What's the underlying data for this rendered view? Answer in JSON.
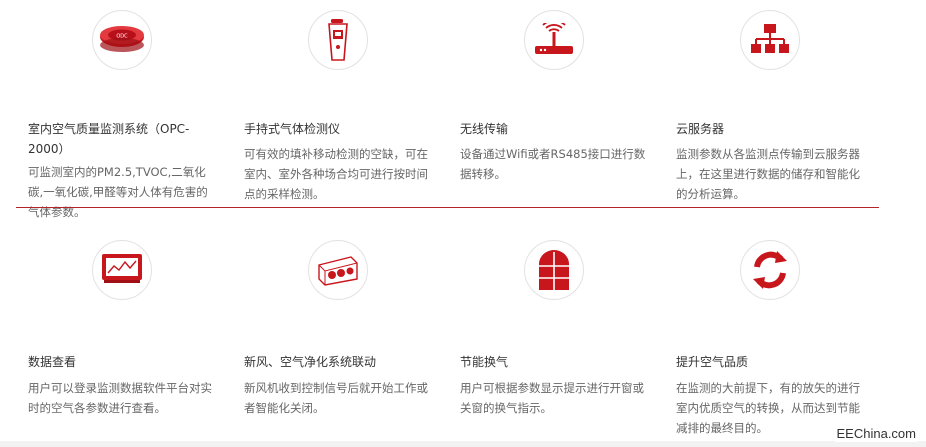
{
  "features": [
    {
      "title": "室内空气质量监测系统（OPC-2000）",
      "desc": "可监测室内的PM2.5,TVOC,二氧化碳,一氧化碳,甲醛等对人体有危害的气体参数。",
      "icon": "ceiling-sensor-icon"
    },
    {
      "title": "手持式气体检测仪",
      "desc": "可有效的填补移动检测的空缺，可在室内、室外各种场合均可进行按时间点的采样检测。",
      "icon": "handheld-detector-icon"
    },
    {
      "title": "无线传输",
      "desc": "设备通过Wifi或者RS485接口进行数据转移。",
      "icon": "wifi-router-icon"
    },
    {
      "title": "云服务器",
      "desc": "监测参数从各监测点传输到云服务器上，在这里进行数据的储存和智能化的分析运算。",
      "icon": "network-servers-icon"
    },
    {
      "title": "数据查看",
      "desc": "用户可以登录监测数据软件平台对实时的空气各参数进行查看。",
      "icon": "monitor-chart-icon"
    },
    {
      "title": "新风、空气净化系统联动",
      "desc": "新风机收到控制信号后就开始工作或者智能化关闭。",
      "icon": "fresh-air-unit-icon"
    },
    {
      "title": "节能换气",
      "desc": "用户可根据参数显示提示进行开窗或关窗的换气指示。",
      "icon": "window-icon"
    },
    {
      "title": "提升空气品质",
      "desc": "在监测的大前提下，有的放矢的进行室内优质空气的转换，从而达到节能减排的最终目的。",
      "icon": "refresh-cycle-icon"
    }
  ],
  "watermark": "EEChina.com",
  "colors": {
    "accent": "#c8161d",
    "divider": "#b4232b"
  }
}
